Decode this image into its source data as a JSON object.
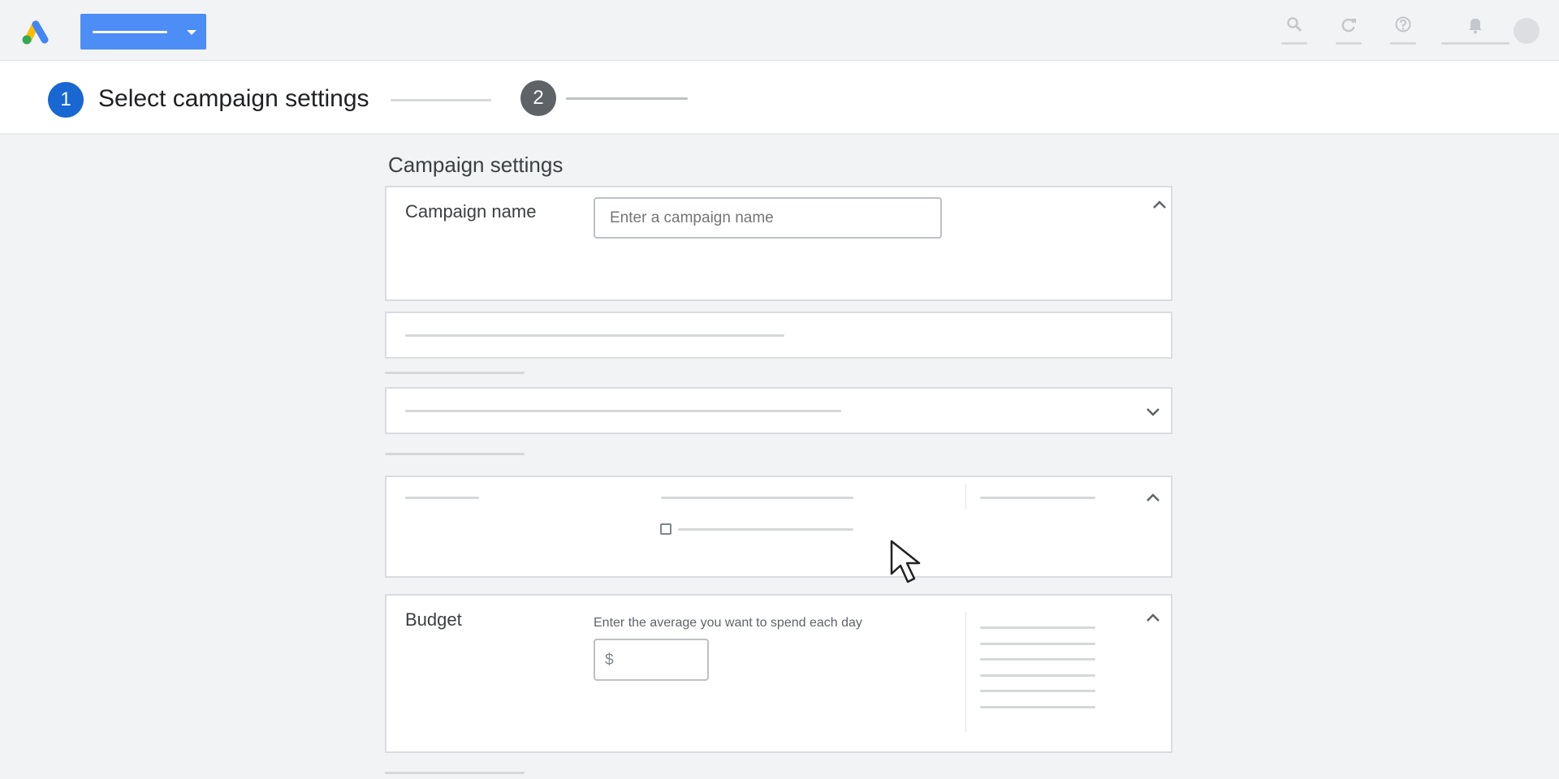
{
  "stepper": {
    "step1_number": "1",
    "step1_title": "Select campaign settings",
    "step2_number": "2"
  },
  "main": {
    "section_title": "Campaign settings",
    "campaign_name": {
      "label": "Campaign name",
      "placeholder": "Enter a campaign name",
      "value": ""
    },
    "budget": {
      "label": "Budget",
      "hint": "Enter the average you want to spend each day",
      "currency_symbol": "$",
      "value": ""
    }
  },
  "header": {
    "icons": [
      "google-ads-logo-icon",
      "search-icon",
      "refresh-icon",
      "help-icon",
      "bell-icon",
      "avatar"
    ]
  },
  "colors": {
    "primary_blue": "#1967d2",
    "button_blue": "#4c8df6",
    "step_inactive": "#5f6368",
    "background": "#f1f3f4"
  }
}
